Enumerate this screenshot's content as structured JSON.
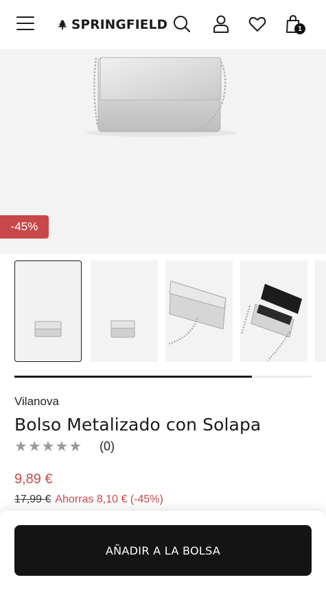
{
  "header": {
    "brand": "SPRINGFIELD",
    "cart_count": "1"
  },
  "product": {
    "discount_badge": "-45%",
    "brand": "Vilanova",
    "title": "Bolso Metalizado con Solapa",
    "rating_stars": 0,
    "rating_count": "(0)",
    "price": "9,89 €",
    "original_price": "17,99 €",
    "savings": "Ahorras 8,10 € (-45%)"
  },
  "gallery": {
    "thumbnail_count": 4,
    "active_index": 0,
    "scroll_progress": 0.8
  },
  "actions": {
    "add_to_bag": "AÑADIR A LA BOLSA"
  },
  "colors": {
    "accent_red": "#c8474a",
    "button_dark": "#141414",
    "star_grey": "#9a9a9a"
  }
}
